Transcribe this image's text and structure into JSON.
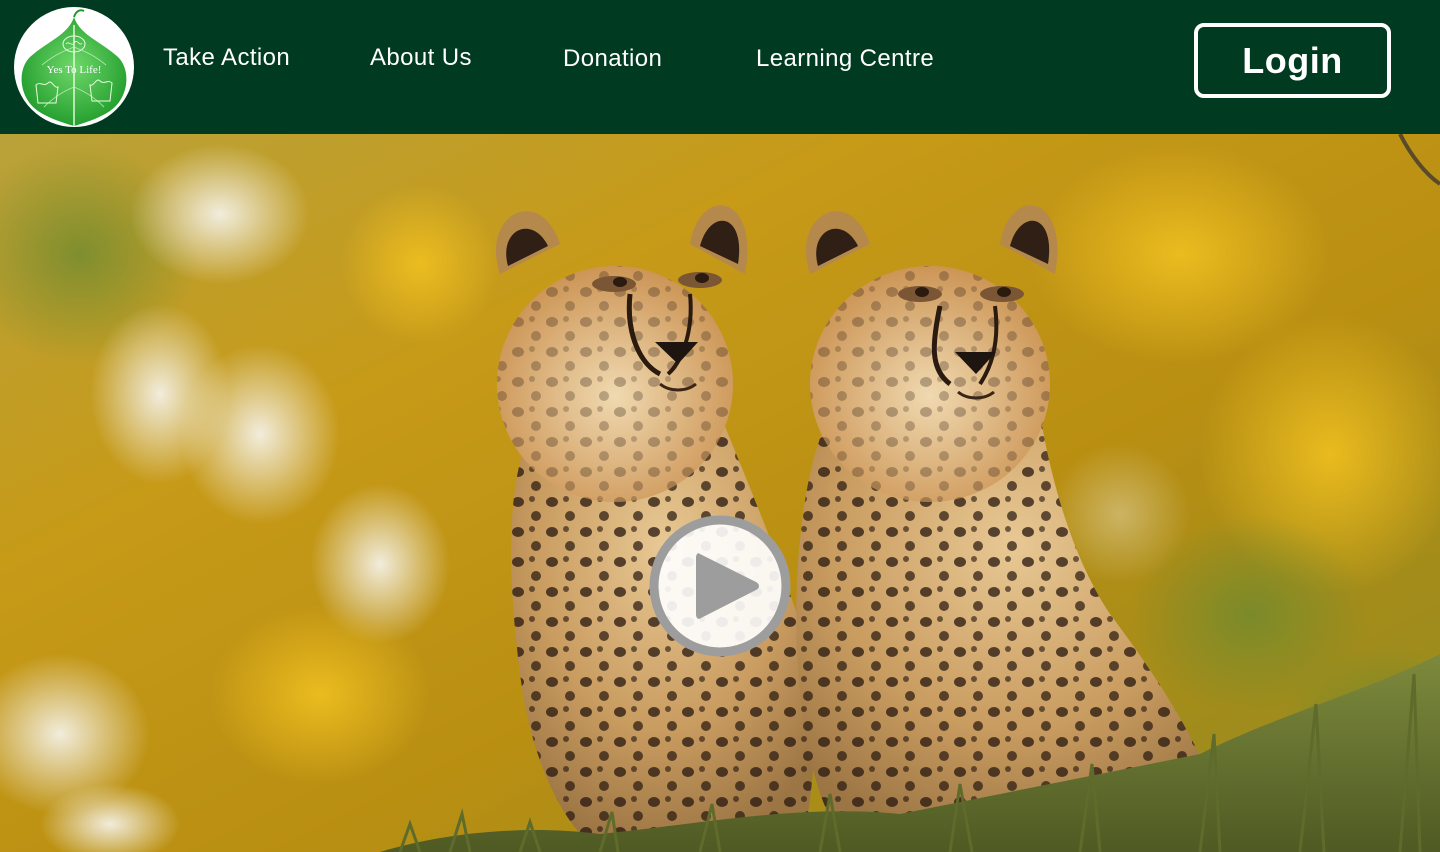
{
  "nav": {
    "logo_text": "Yes To Life!",
    "links": [
      {
        "label": "Take Action"
      },
      {
        "label": "About Us"
      },
      {
        "label": "Donation"
      },
      {
        "label": "Learning Centre"
      }
    ],
    "login_label": "Login"
  },
  "hero": {
    "media_type": "video",
    "subject": "two cheetah cubs sitting in grass",
    "play_icon": "play-icon"
  },
  "colors": {
    "nav_background": "#003a20",
    "nav_text": "#ffffff",
    "logo_leaf": "#2fb236",
    "play_fill": "#ffffff",
    "play_ring": "#9d9d9d"
  }
}
